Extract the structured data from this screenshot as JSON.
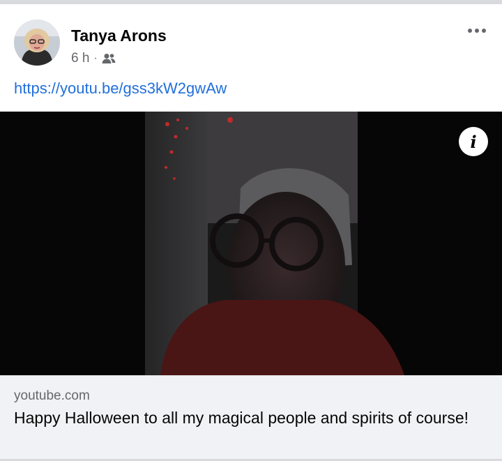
{
  "post": {
    "author": "Tanya Arons",
    "time": "6 h",
    "separator": "·",
    "audience_icon": "friends-icon",
    "more_icon": "more-options-icon",
    "link_text": "https://youtu.be/gss3kW2gwAw"
  },
  "media": {
    "info_icon": "info-icon",
    "info_glyph": "i"
  },
  "link_preview": {
    "domain": "youtube.com",
    "title": "Happy Halloween to all my magical people and spirits of course!"
  },
  "colors": {
    "link": "#216fdb",
    "text_primary": "#050505",
    "text_secondary": "#65676b",
    "preview_bg": "#f0f2f5"
  }
}
